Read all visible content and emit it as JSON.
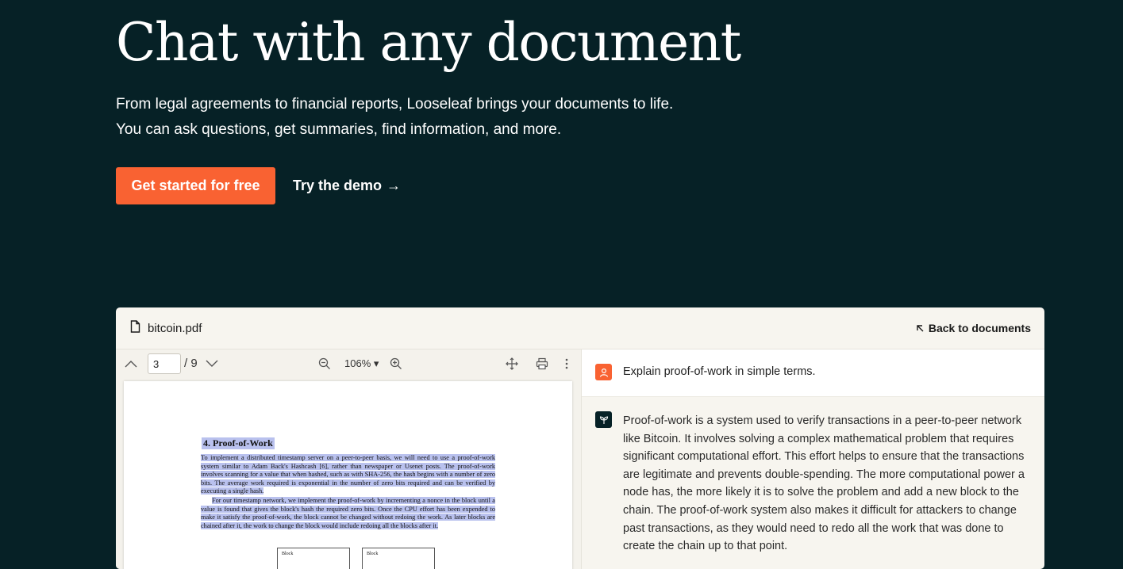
{
  "hero": {
    "title": "Chat with any document",
    "subtitle_line1": "From legal agreements to financial reports, Looseleaf brings your documents to life.",
    "subtitle_line2": "You can ask questions, get summaries, find information, and more.",
    "primary_cta": "Get started for free",
    "secondary_cta": "Try the demo",
    "secondary_cta_arrow": "→"
  },
  "app": {
    "file_name": "bitcoin.pdf",
    "back_label": "Back to documents",
    "viewer": {
      "page_current": "3",
      "page_total": "/ 9",
      "zoom": "106% ▾"
    },
    "pdf": {
      "section_title": "4.    Proof-of-Work",
      "para1": "To implement a distributed timestamp server on a peer-to-peer basis, we will need to use a proof-of-work system similar to Adam Back's Hashcash [6], rather than newspaper or Usenet posts. The proof-of-work involves scanning for a value that when hashed, such as with SHA-256, the hash begins with a number of zero bits. The average work required is exponential in the number of zero bits required and can be verified by executing a single hash.",
      "para2": "For our timestamp network, we implement the proof-of-work by incrementing a nonce in the block until a value is found that gives the block's hash the required zero bits. Once the CPU effort has been expended to make it satisfy the proof-of-work, the block cannot be changed without redoing the work. As later blocks are chained after it, the work to change the block would include redoing all the blocks after it.",
      "block1": "Block",
      "block2": "Block"
    },
    "chat": {
      "question": "Explain proof-of-work in simple terms.",
      "answer": "Proof-of-work is a system used to verify transactions in a peer-to-peer network like Bitcoin. It involves solving a complex mathematical problem that requires significant computational effort. This effort helps to ensure that the transactions are legitimate and prevents double-spending. The more computational power a node has, the more likely it is to solve the problem and add a new block to the chain. The proof-of-work system also makes it difficult for attackers to change past transactions, as they would need to redo all the work that was done to create the chain up to that point."
    }
  },
  "colors": {
    "background": "#062126",
    "accent": "#f96232",
    "highlight": "#b9c1ee",
    "panel": "#f7f5ef"
  },
  "icons": [
    "file-icon",
    "arrow-up-left-icon",
    "chevron-up-icon",
    "chevron-down-icon",
    "zoom-out-icon",
    "zoom-in-icon",
    "move-icon",
    "print-icon",
    "more-vertical-icon",
    "user-avatar-icon",
    "leaf-logo-icon",
    "arrow-right-icon"
  ]
}
